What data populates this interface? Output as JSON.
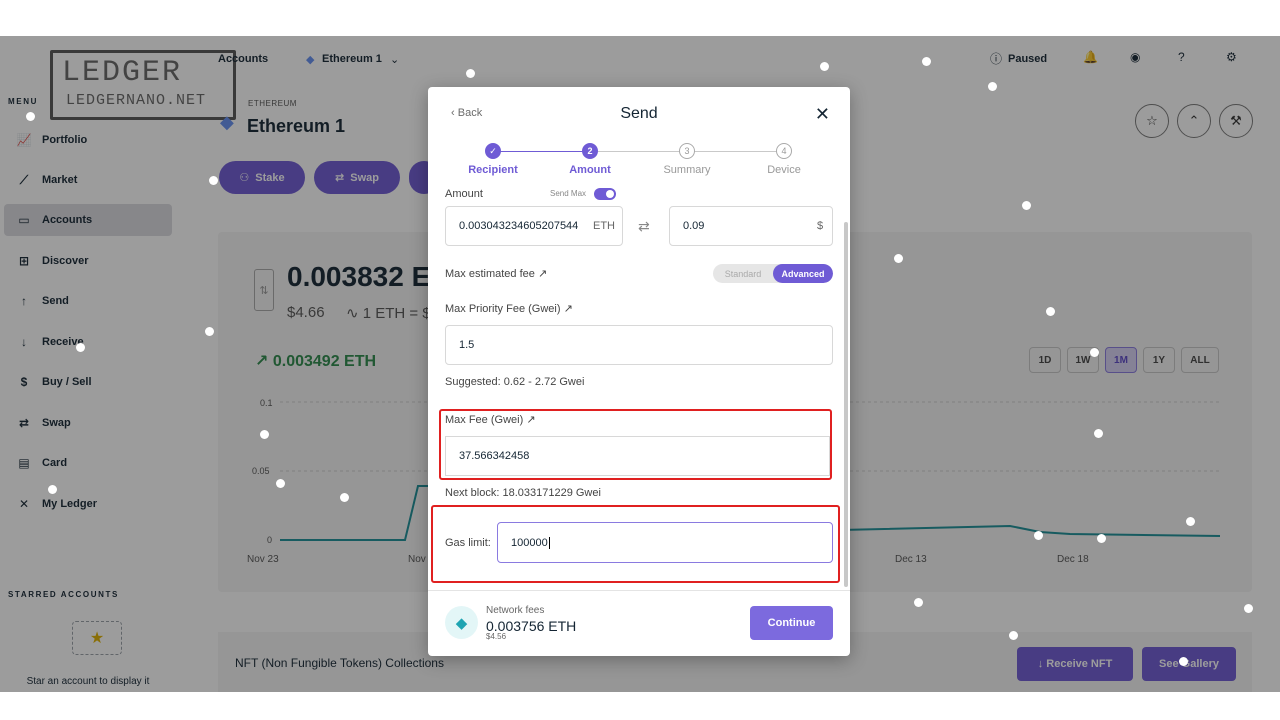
{
  "watermark": {
    "line1": "LEDGER",
    "line2": "LEDGERNANO.NET"
  },
  "sidebar": {
    "menu_label": "MENU",
    "items": [
      {
        "label": "Portfolio",
        "icon": "chart-line-icon"
      },
      {
        "label": "Market",
        "icon": "market-icon"
      },
      {
        "label": "Accounts",
        "icon": "wallet-icon"
      },
      {
        "label": "Discover",
        "icon": "grid-icon"
      },
      {
        "label": "Send",
        "icon": "arrow-up-icon"
      },
      {
        "label": "Receive",
        "icon": "arrow-down-icon"
      },
      {
        "label": "Buy / Sell",
        "icon": "dollar-icon"
      },
      {
        "label": "Swap",
        "icon": "swap-icon"
      },
      {
        "label": "Card",
        "icon": "card-icon"
      },
      {
        "label": "My Ledger",
        "icon": "tools-icon"
      }
    ],
    "starred_label": "STARRED ACCOUNTS",
    "starred_hint": "Star an account to display it"
  },
  "topbar": {
    "accounts": "Accounts",
    "account_name": "Ethereum 1",
    "paused": "Paused"
  },
  "page": {
    "crumb": "ETHEREUM",
    "title": "Ethereum 1",
    "actions": [
      "Stake",
      "Swap"
    ],
    "balance": "0.003832 E",
    "balance_usd": "$4.66",
    "rate": "1 ETH = $",
    "gain": "0.003492 ETH",
    "y_ticks": [
      "0.1",
      "0.05",
      "0"
    ],
    "x_ticks": [
      "Nov 23",
      "Nov",
      "Dec 13",
      "Dec 18"
    ],
    "ranges": [
      "1D",
      "1W",
      "1M",
      "1Y",
      "ALL"
    ],
    "selected_range": "1M",
    "nft_title": "NFT (Non Fungible Tokens) Collections",
    "receive_nft": "Receive NFT",
    "see_gallery": "See Gallery"
  },
  "modal": {
    "back": "Back",
    "title": "Send",
    "steps": [
      "Recipient",
      "Amount",
      "Summary",
      "Device"
    ],
    "step_numbers": [
      "2",
      "3",
      "4"
    ],
    "current_step": 2,
    "amount_label": "Amount",
    "send_max_label": "Send Max",
    "amount_eth": "0.003043234605207544",
    "amount_unit": "ETH",
    "amount_usd": "0.09",
    "usd_unit": "$",
    "fee_label": "Max estimated fee",
    "fee_modes": [
      "Standard",
      "Advanced"
    ],
    "priority_label": "Max Priority Fee (Gwei)",
    "priority_value": "1.5",
    "suggested": "Suggested: 0.62 - 2.72 Gwei",
    "max_fee_label": "Max Fee (Gwei)",
    "max_fee_value": "37.566342458",
    "next_block": "Next block: 18.033171229 Gwei",
    "gas_label": "Gas limit:",
    "gas_value": "100000",
    "network_fees_label": "Network fees",
    "network_fees_value": "0.003756 ETH",
    "network_fees_usd": "$4.56",
    "continue": "Continue"
  },
  "colors": {
    "accent": "#6f5bd5",
    "highlight": "#e02020",
    "gain": "#2b8a4a"
  }
}
